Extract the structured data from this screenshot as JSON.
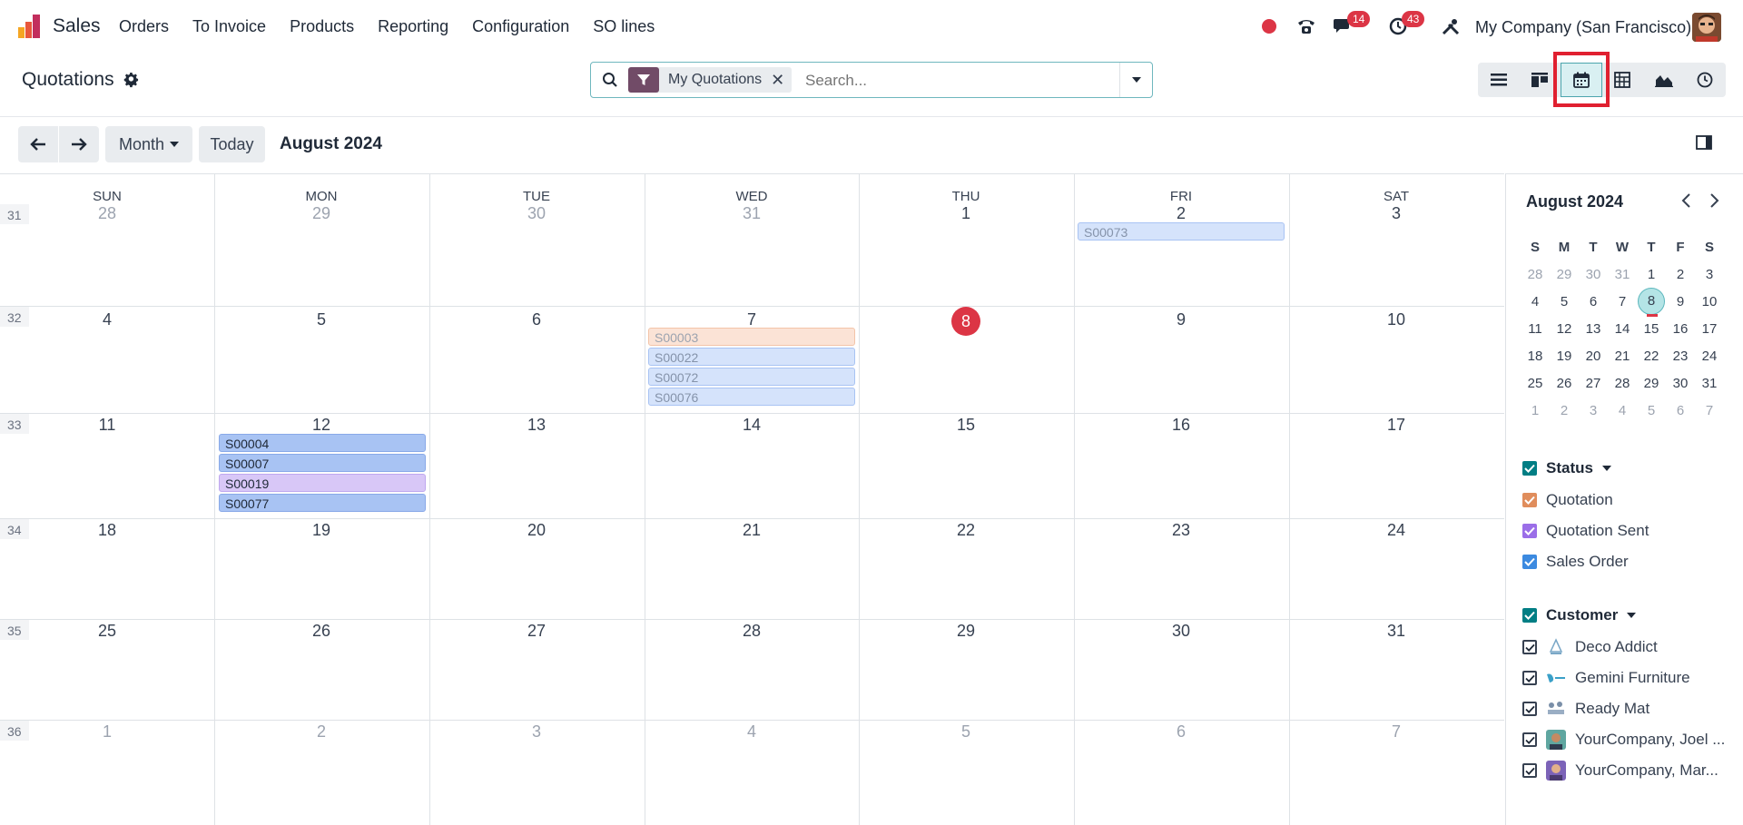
{
  "navbar": {
    "app_name": "Sales",
    "menu": [
      "Orders",
      "To Invoice",
      "Products",
      "Reporting",
      "Configuration",
      "SO lines"
    ],
    "messages_count": "14",
    "activities_count": "43",
    "company": "My Company (San Francisco)"
  },
  "control_panel": {
    "title": "Quotations",
    "facet_label": "My Quotations",
    "search_placeholder": "Search..."
  },
  "toolbar": {
    "scale_label": "Month",
    "today_label": "Today",
    "period_title": "August 2024"
  },
  "calendar": {
    "weekdays": [
      "SUN",
      "MON",
      "TUE",
      "WED",
      "THU",
      "FRI",
      "SAT"
    ],
    "weeks": [
      {
        "num": "31",
        "days": [
          "28",
          "29",
          "30",
          "31",
          "1",
          "2",
          "3"
        ]
      },
      {
        "num": "32",
        "days": [
          "4",
          "5",
          "6",
          "7",
          "8",
          "9",
          "10"
        ]
      },
      {
        "num": "33",
        "days": [
          "11",
          "12",
          "13",
          "14",
          "15",
          "16",
          "17"
        ]
      },
      {
        "num": "34",
        "days": [
          "18",
          "19",
          "20",
          "21",
          "22",
          "23",
          "24"
        ]
      },
      {
        "num": "35",
        "days": [
          "25",
          "26",
          "27",
          "28",
          "29",
          "30",
          "31"
        ]
      },
      {
        "num": "36",
        "days": [
          "1",
          "2",
          "3",
          "4",
          "5",
          "6",
          "7"
        ]
      }
    ],
    "events": {
      "fri2": [
        "S00073"
      ],
      "wed7": [
        "S00003",
        "S00022",
        "S00072",
        "S00076"
      ],
      "mon12": [
        "S00004",
        "S00007",
        "S00019",
        "S00077"
      ]
    }
  },
  "mini_calendar": {
    "title": "August 2024",
    "weekdays": [
      "S",
      "M",
      "T",
      "W",
      "T",
      "F",
      "S"
    ],
    "weeks": [
      [
        "28",
        "29",
        "30",
        "31",
        "1",
        "2",
        "3"
      ],
      [
        "4",
        "5",
        "6",
        "7",
        "8",
        "9",
        "10"
      ],
      [
        "11",
        "12",
        "13",
        "14",
        "15",
        "16",
        "17"
      ],
      [
        "18",
        "19",
        "20",
        "21",
        "22",
        "23",
        "24"
      ],
      [
        "25",
        "26",
        "27",
        "28",
        "29",
        "30",
        "31"
      ],
      [
        "1",
        "2",
        "3",
        "4",
        "5",
        "6",
        "7"
      ]
    ]
  },
  "filters": {
    "status": {
      "title": "Status",
      "items": [
        "Quotation",
        "Quotation Sent",
        "Sales Order"
      ]
    },
    "customer": {
      "title": "Customer",
      "items": [
        "Deco Addict",
        "Gemini Furniture",
        "Ready Mat",
        "YourCompany, Joel ...",
        "YourCompany, Mar..."
      ]
    }
  },
  "colors": {
    "accent": "#017e84",
    "brand": "#714b67",
    "today": "#dc3545",
    "highlight": "#e02030"
  }
}
